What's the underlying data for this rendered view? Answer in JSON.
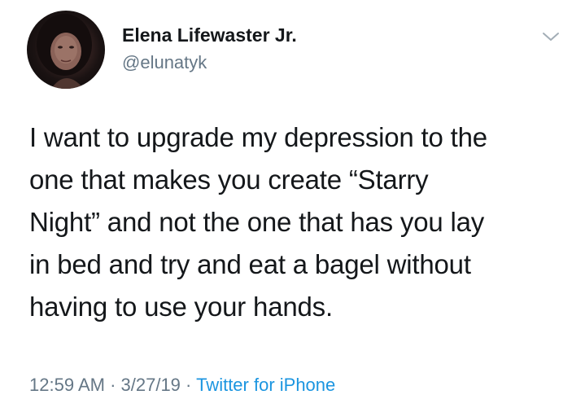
{
  "author": {
    "display_name": "Elena Lifewaster Jr.",
    "handle": "@elunatyk",
    "avatar_icon": "profile-photo"
  },
  "menu": {
    "icon": "chevron-down-icon"
  },
  "tweet": {
    "text": "I want to upgrade my depression to the\none that makes you create “Starry\nNight” and not the one that has you lay\nin bed and try and eat a bagel without\nhaving to use your hands."
  },
  "meta": {
    "time": "12:59 AM",
    "sep1": " · ",
    "date": "3/27/19",
    "sep2": " · ",
    "source": "Twitter for iPhone"
  },
  "colors": {
    "text": "#14171a",
    "secondary": "#657786",
    "link": "#1b95e0",
    "background": "#ffffff"
  }
}
